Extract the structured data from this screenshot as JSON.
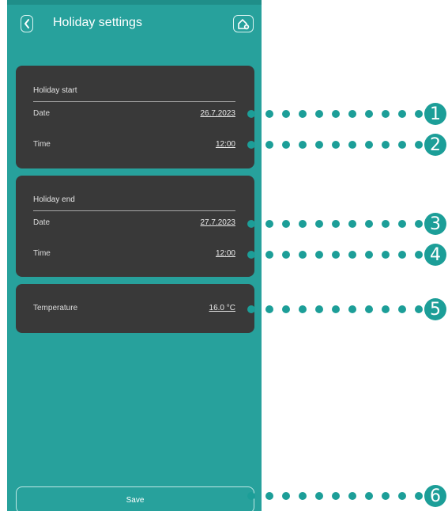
{
  "header": {
    "title": "Holiday settings",
    "back_icon": "chevron-left-icon",
    "home_icon": "home-add-icon"
  },
  "holiday_start": {
    "title": "Holiday start",
    "date_label": "Date",
    "date_value": "26.7.2023",
    "time_label": "Time",
    "time_value": "12:00"
  },
  "holiday_end": {
    "title": "Holiday end",
    "date_label": "Date",
    "date_value": "27.7.2023",
    "time_label": "Time",
    "time_value": "12:00"
  },
  "temperature": {
    "label": "Temperature",
    "value": "16.0 °C"
  },
  "save_label": "Save",
  "callouts": [
    "1",
    "2",
    "3",
    "4",
    "5",
    "6"
  ],
  "colors": {
    "screen_bg": "#27a19c",
    "card_bg": "#393939",
    "callout": "#1c9e98"
  }
}
